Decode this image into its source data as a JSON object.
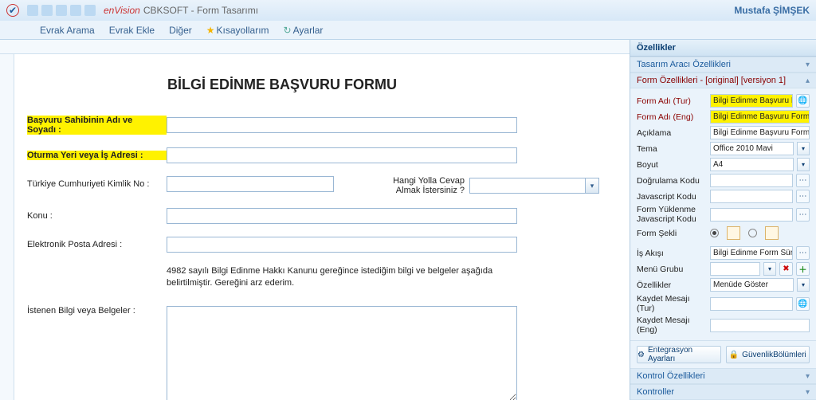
{
  "titlebar": {
    "brand": "enVision",
    "app_title": "CBKSOFT - Form Tasarımı",
    "user": "Mustafa ŞİMŞEK"
  },
  "menubar": {
    "items": [
      "Evrak Arama",
      "Evrak Ekle",
      "Diğer",
      "Kısayollarım",
      "Ayarlar"
    ]
  },
  "floating_tag": "db_cvp_list",
  "form": {
    "title": "BİLGİ EDİNME BAŞVURU FORMU",
    "labels": {
      "name": "Başvuru Sahibinin Adı ve Soyadı :",
      "address": "Oturma Yeri veya İş Adresi :",
      "tc": "Türkiye Cumhuriyeti Kimlik No :",
      "reply_by": "Hangi Yolla Cevap Almak İstersiniz ?",
      "subject": "Konu :",
      "email": "Elektronik Posta Adresi :",
      "requested": "İstenen Bilgi veya Belgeler :"
    },
    "note": "4982 sayılı Bilgi Edinme Hakkı Kanunu gereğince istediğim bilgi ve belgeler aşağıda belirtilmiştir. Gereğini arz ederim."
  },
  "panel": {
    "header": "Özellikler",
    "sections": {
      "tool": "Tasarım Aracı Özellikleri",
      "form": "Form Özellikleri - [original] [versiyon 1]",
      "kontrol_oz": "Kontrol Özellikleri",
      "kontroller": "Kontroller"
    },
    "labels": {
      "form_adi_tur": "Form Adı (Tur)",
      "form_adi_eng": "Form Adı (Eng)",
      "aciklama": "Açıklama",
      "tema": "Tema",
      "boyut": "Boyut",
      "dogrulama": "Doğrulama Kodu",
      "js": "Javascript Kodu",
      "form_yuk_js": "Form Yüklenme Javascript Kodu",
      "form_sekli": "Form Şekli",
      "is_akisi": "İş Akışı",
      "menu_grubu": "Menü Grubu",
      "ozellikler": "Özellikler",
      "kaydet_tur": "Kaydet Mesajı (Tur)",
      "kaydet_eng": "Kaydet Mesajı (Eng)"
    },
    "values": {
      "form_adi_tur": "Bilgi Edinme Başvuru Formu",
      "form_adi_eng": "Bilgi Edinme Başvuru Formu",
      "aciklama": "Bilgi Edinme Başvuru Formu",
      "tema": "Office 2010 Mavi",
      "boyut": "A4",
      "is_akisi": "Bilgi Edinme Form Süreci",
      "ozellikler": "Menüde Göster"
    },
    "buttons": {
      "integration": "Entegrasyon Ayarları",
      "security": "GüvenlikBölümleri"
    }
  }
}
